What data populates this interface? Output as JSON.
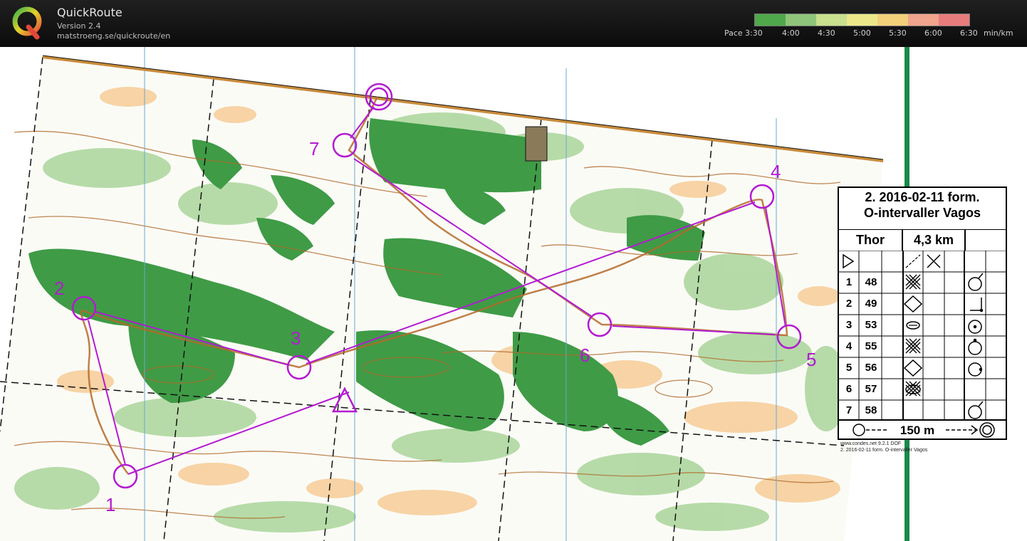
{
  "app": {
    "name": "QuickRoute",
    "version": "Version 2.4",
    "url": "matstroeng.se/quickroute/en",
    "logo_letter": "Q"
  },
  "pace_scale": {
    "prefix": "Pace",
    "labels": [
      "3:30",
      "4:00",
      "4:30",
      "5:00",
      "5:30",
      "6:00",
      "6:30"
    ],
    "unit": "min/km",
    "colors": [
      "#4fa84a",
      "#8fc57a",
      "#c9e08e",
      "#ece88a",
      "#f3d17a",
      "#f0a58c",
      "#e87c7c"
    ]
  },
  "map": {
    "colors": {
      "forest": "#3e9c45",
      "light_forest": "#a8d49a",
      "open": "#f7c98c",
      "contour": "#b06a2a",
      "course": "#b21bd1",
      "route": "#b46a2a",
      "meridian": "#6aa9d0",
      "green_bar": "#1a8a4a"
    },
    "control_labels": [
      "1",
      "2",
      "3",
      "4",
      "5",
      "6",
      "7"
    ]
  },
  "legend": {
    "title_line1": "2. 2016-02-11 form.",
    "title_line2": "O-intervaller Vagos",
    "runner": "Thor",
    "distance": "4,3 km",
    "controls": [
      {
        "num": "1",
        "code": "48"
      },
      {
        "num": "2",
        "code": "49"
      },
      {
        "num": "3",
        "code": "53"
      },
      {
        "num": "4",
        "code": "55"
      },
      {
        "num": "5",
        "code": "56"
      },
      {
        "num": "6",
        "code": "57"
      },
      {
        "num": "7",
        "code": "58"
      }
    ],
    "finish_distance": "150 m"
  },
  "footer": {
    "line1": "www.condes.net 9.2.1 DOF",
    "line2": "2. 2016-02-11 form. O-intervaller Vagos"
  }
}
